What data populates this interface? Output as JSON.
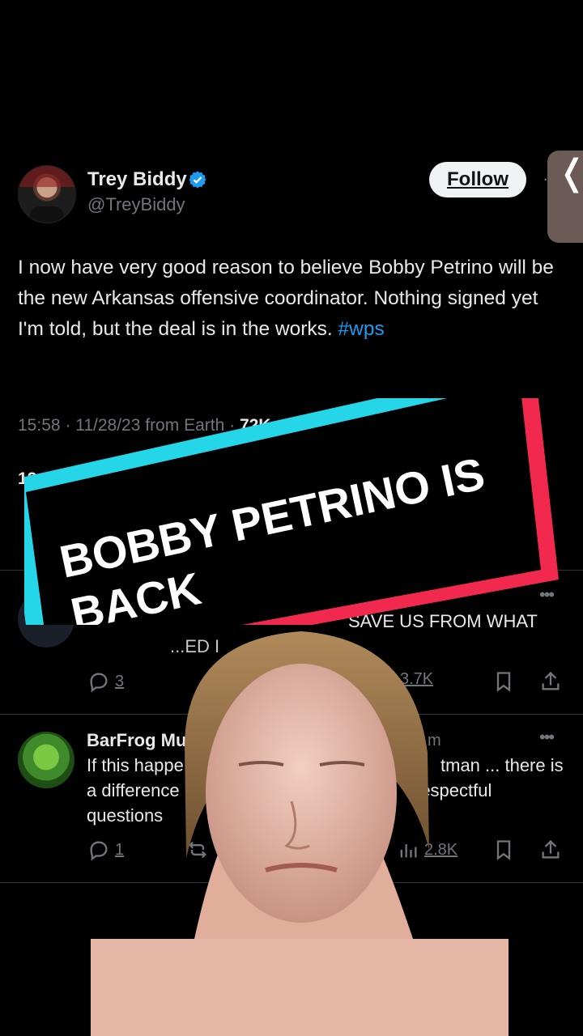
{
  "tweet": {
    "name": "Trey Biddy",
    "handle": "@TreyBiddy",
    "follow_label": "Follow",
    "more_label": "·",
    "text_main": "I now have very good reason to believe Bobby Petrino will be the new Arkansas offensive coordinator. Nothing signed yet I'm told, but the deal is in the works. ",
    "hashtag": "#wps",
    "meta_prefix": "15:58 · 11/28/23 from Earth · ",
    "meta_views": "72K",
    "stats_peek": "12"
  },
  "side_tab": {
    "glyph": "❬"
  },
  "overlay": {
    "headline": "BOBBY PETRINO IS BACK",
    "colors": {
      "cyan": "#25d5e8",
      "pink": "#f2294f",
      "black": "#000000",
      "text": "#ffffff"
    }
  },
  "replies": [
    {
      "name": "",
      "time": "",
      "more": "•••",
      "text": "SAVE US FROM WHAT",
      "text_line2": "...ED I",
      "replies_count": "3",
      "views_count": "3.7K"
    },
    {
      "name": "BarFrog Mu",
      "time": "m",
      "more": "•••",
      "text_l1a": "If this happe",
      "text_l1b": "tman ... there is",
      "text_l2a": "a difference i",
      "text_l2b": "respectful",
      "text_l3": "questions",
      "replies_count": "1",
      "views_count": "2.8K"
    }
  ],
  "colors": {
    "background": "#000000",
    "text": "#e7e9ea",
    "muted": "#71767b",
    "link": "#1d9bf0",
    "verified": "#1d9bf0"
  },
  "icons": [
    "verified-badge-icon",
    "reply-icon",
    "retweet-icon",
    "views-icon",
    "bookmark-icon",
    "share-icon",
    "more-icon"
  ]
}
